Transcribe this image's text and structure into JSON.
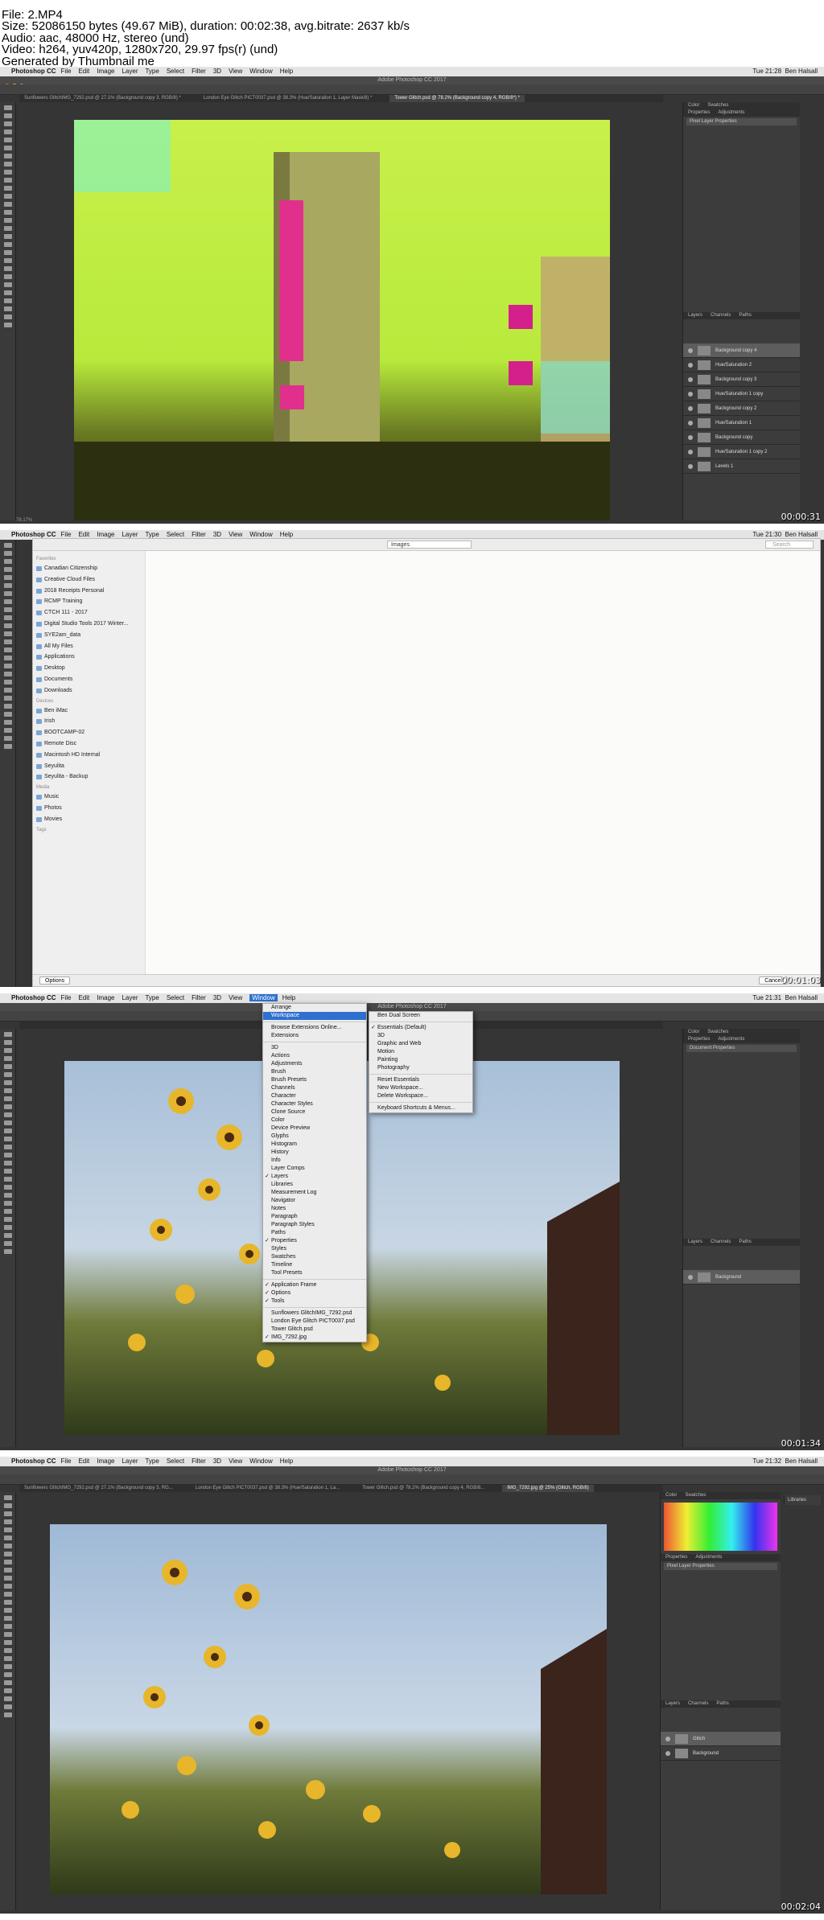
{
  "header": {
    "lines": [
      "File: 2.MP4",
      "Size: 52086150 bytes (49.67 MiB), duration: 00:02:38, avg.bitrate: 2637 kb/s",
      "Audio: aac, 48000 Hz, stereo (und)",
      "Video: h264, yuv420p, 1280x720, 29.97 fps(r) (und)",
      "Generated by Thumbnail me"
    ]
  },
  "app": {
    "name": "Photoshop CC",
    "window_title": "Adobe Photoshop CC 2017",
    "user": "Ben Halsall",
    "menus": [
      "File",
      "Edit",
      "Image",
      "Layer",
      "Type",
      "Select",
      "Filter",
      "3D",
      "View",
      "Window",
      "Help"
    ]
  },
  "frames": [
    {
      "time": "Tue 21:28",
      "timecode": "00:00:31",
      "tabs": [
        "Sunflowers GlitchIMG_7292.psd @ 27.1% (Background copy 3, RGB/8) *",
        "London Eye Glitch PICT0037.psd @ 38.3% (Hue/Saturation 1, Layer Mask/8) *",
        "Tower Glitch.psd @ 78.2% (Background copy 4, RGB/8*) *"
      ],
      "status": "78.17%",
      "panel_tabs": [
        "Color",
        "Swatches"
      ],
      "prop_tabs": [
        "Properties",
        "Adjustments"
      ],
      "prop_title": "Pixel Layer Properties",
      "layers_tabs": [
        "Layers",
        "Channels",
        "Paths"
      ],
      "layers": [
        "Background copy 4",
        "Hue/Saturation 2",
        "Background copy 3",
        "Hue/Saturation 1 copy",
        "Background copy 2",
        "Hue/Saturation 1",
        "Background copy",
        "Hue/Saturation 1 copy 2",
        "Levels 1"
      ]
    },
    {
      "time": "Tue 21:30",
      "timecode": "00:01:03",
      "popup": "Images",
      "search": "Search",
      "sidebar": {
        "favorites_label": "Favorites",
        "favorites": [
          "Canadian Citizenship",
          "Creative Cloud Files",
          "2018 Receipts Personal",
          "RCMP Training",
          "CTCH 111 - 2017",
          "Digital Studio Tools 2017 Winter...",
          "SYE2am_data",
          "All My Files",
          "Applications",
          "Desktop",
          "Documents",
          "Downloads"
        ],
        "devices_label": "Devices",
        "devices": [
          "Ben iMac",
          "Irish",
          "BOOTCAMP-02",
          "Remote Disc",
          "Macintosh HD Internal",
          "Seyulita",
          "Seyulita - Backup"
        ],
        "media_label": "Media",
        "media": [
          "Music",
          "Photos",
          "Movies"
        ],
        "tags_label": "Tags"
      },
      "options": "Options",
      "cancel": "Cancel"
    },
    {
      "time": "Tue 21:31",
      "timecode": "00:01:34",
      "window_menu": [
        "Arrange",
        "Workspace",
        "Browse Extensions Online...",
        "Extensions",
        "3D",
        "Actions",
        "Adjustments",
        "Brush",
        "Brush Presets",
        "Channels",
        "Character",
        "Character Styles",
        "Clone Source",
        "Color",
        "Device Preview",
        "Glyphs",
        "Histogram",
        "History",
        "Info",
        "Layer Comps",
        "Layers",
        "Libraries",
        "Measurement Log",
        "Navigator",
        "Notes",
        "Paragraph",
        "Paragraph Styles",
        "Paths",
        "Properties",
        "Styles",
        "Swatches",
        "Timeline",
        "Tool Presets",
        "Application Frame",
        "Options",
        "Tools",
        "Sunflowers GlitchIMG_7292.psd",
        "London Eye Glitch PICT0037.psd",
        "Tower Glitch.psd",
        "IMG_7292.jpg"
      ],
      "workspace_menu": [
        "Ben Dual Screen",
        "Essentials (Default)",
        "3D",
        "Graphic and Web",
        "Motion",
        "Painting",
        "Photography",
        "Reset Essentials",
        "New Workspace...",
        "Delete Workspace...",
        "Keyboard Shortcuts & Menus..."
      ],
      "prop_title": "Document Properties",
      "layers": [
        "Background"
      ]
    },
    {
      "time": "Tue 21:32",
      "timecode": "00:02:04",
      "tabs": [
        "Sunflowers GlitchIMG_7292.psd @ 27.1% (Background copy 3, RG...",
        "London Eye Glitch PICT0037.psd @ 38.3% (Hue/Saturation 1, La...",
        "Tower Glitch.psd @ 78.2% (Background copy 4, RGB/8...",
        "IMG_7292.jpg @ 25% (Glitch, RGB/8)"
      ],
      "libraries": "Libraries",
      "layers": [
        "Glitch",
        "Background"
      ]
    }
  ]
}
